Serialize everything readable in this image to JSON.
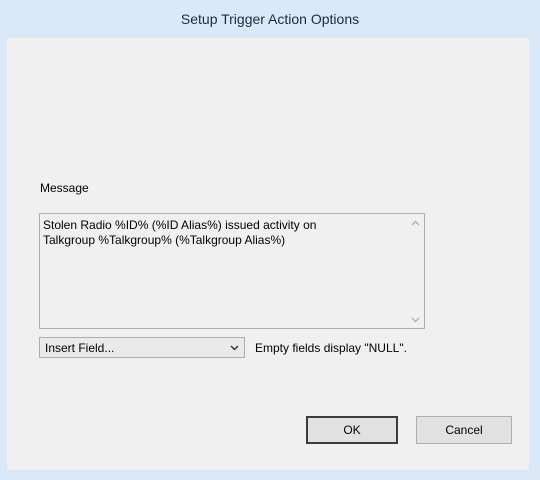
{
  "window": {
    "title": "Setup Trigger Action Options"
  },
  "message": {
    "label": "Message",
    "text": "Stolen Radio %ID% (%ID Alias%) issued activity on\nTalkgroup %Talkgroup% (%Talkgroup Alias%)"
  },
  "insert_field": {
    "selected": "Insert Field..."
  },
  "hint": "Empty fields display \"NULL\".",
  "buttons": {
    "ok": "OK",
    "cancel": "Cancel"
  },
  "icons": {
    "scroll_up": "chevron-up-icon",
    "scroll_down": "chevron-down-icon",
    "dropdown": "chevron-down-icon"
  }
}
